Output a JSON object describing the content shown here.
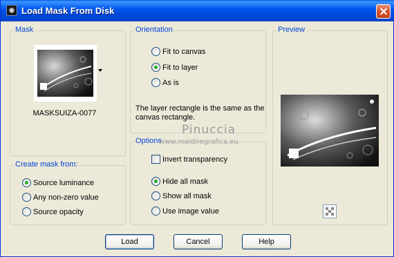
{
  "window": {
    "title": "Load Mask From Disk"
  },
  "mask": {
    "legend": "Mask",
    "name": "MASKSUIZA-0077"
  },
  "orientation": {
    "legend": "Orientation",
    "options": [
      {
        "label": "Fit to canvas",
        "checked": false
      },
      {
        "label": "Fit to layer",
        "checked": true
      },
      {
        "label": "As is",
        "checked": false
      }
    ],
    "description": "The layer rectangle is the same as the canvas rectangle."
  },
  "create_mask": {
    "legend": "Create mask from:",
    "options": [
      {
        "label": "Source luminance",
        "checked": true
      },
      {
        "label": "Any non-zero value",
        "checked": false
      },
      {
        "label": "Source opacity",
        "checked": false
      }
    ]
  },
  "options": {
    "legend": "Options",
    "invert_label": "Invert transparency",
    "invert_checked": false,
    "mask_options": [
      {
        "label": "Hide all mask",
        "checked": true
      },
      {
        "label": "Show all mask",
        "checked": false
      },
      {
        "label": "Use image value",
        "checked": false
      }
    ]
  },
  "preview": {
    "legend": "Preview"
  },
  "watermark": {
    "title": "Pinuccia",
    "url": "www.maidiregrafica.eu"
  },
  "buttons": {
    "load": "Load",
    "cancel": "Cancel",
    "help": "Help"
  },
  "colors": {
    "titlebar": "#0054e3",
    "legend_text": "#0046d5",
    "dialog_bg": "#ece9d8"
  },
  "icons": {
    "title": "mask-app-icon",
    "close": "close-icon",
    "preview_tool": "checker-icon"
  }
}
